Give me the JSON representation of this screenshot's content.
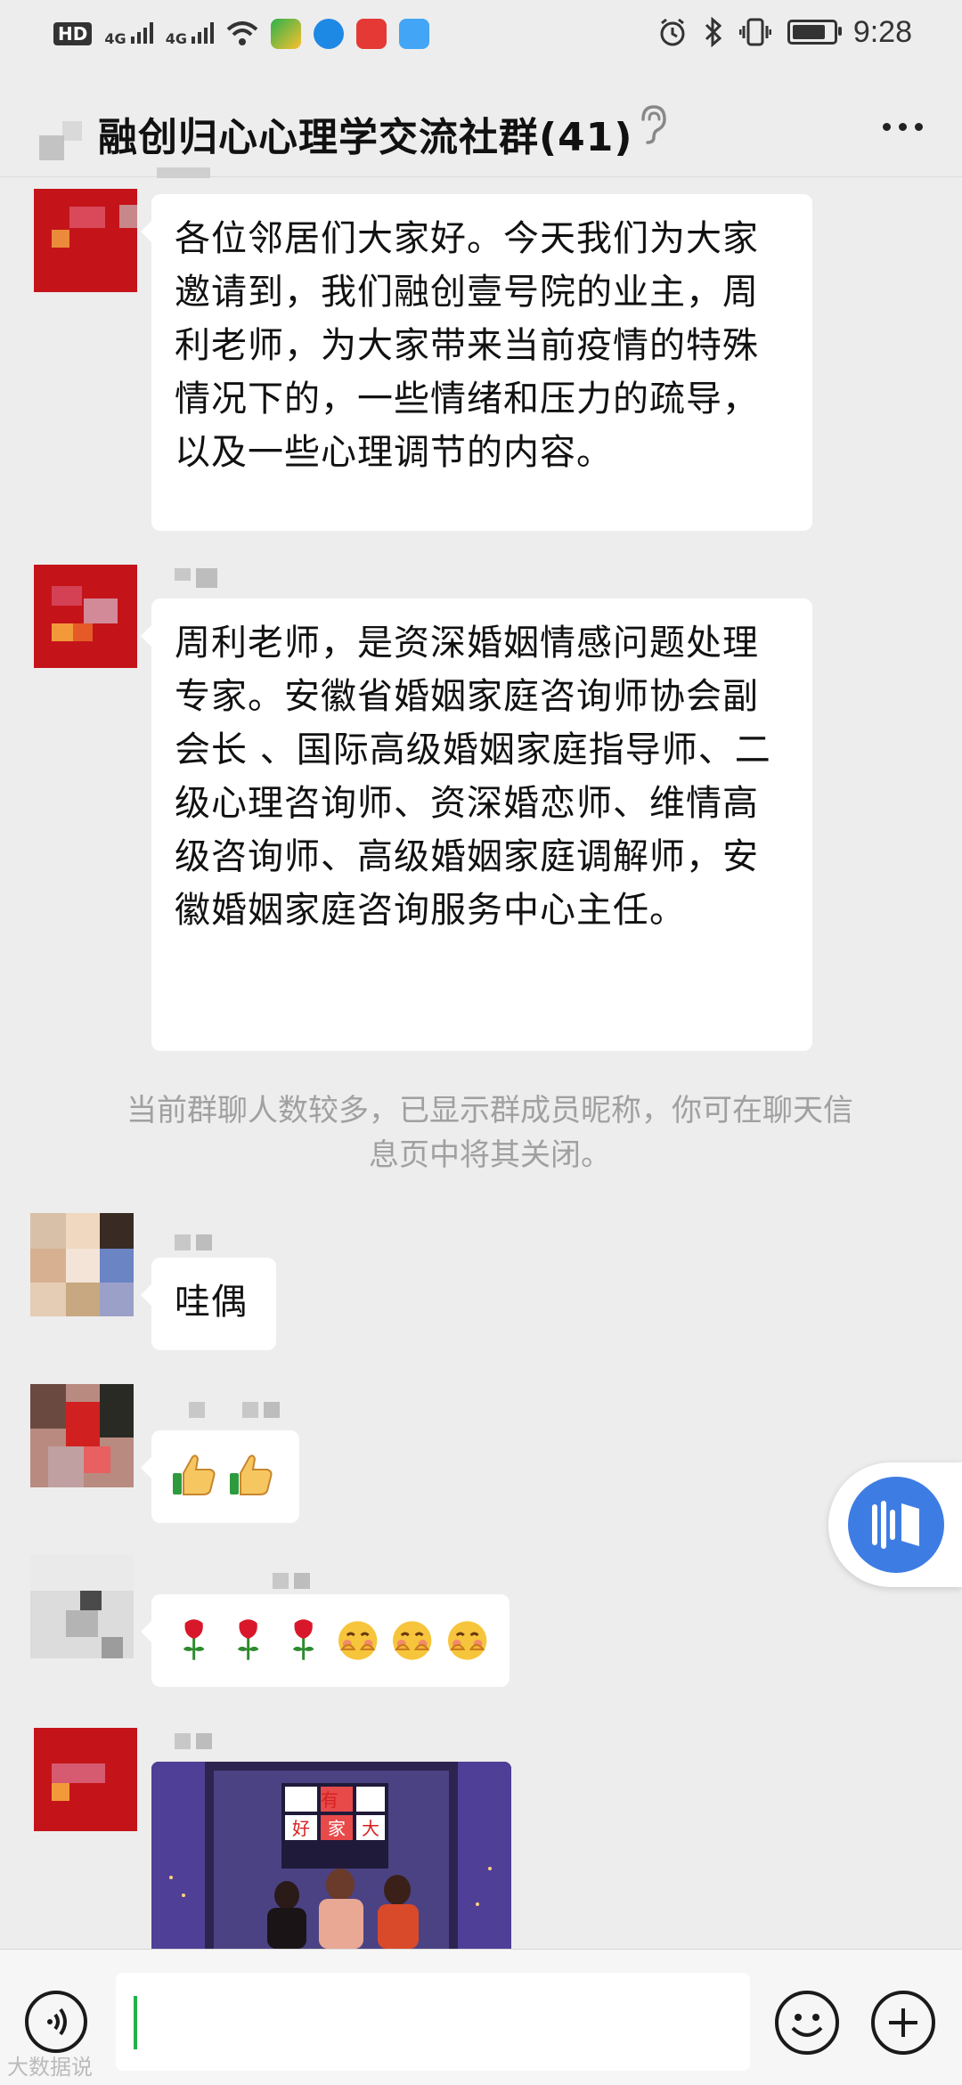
{
  "status_bar": {
    "network": "HD",
    "signal1": "4G",
    "signal2": "4G",
    "time": "9:28"
  },
  "header": {
    "title": "融创归心心理学交流社群(41)",
    "icons": [
      "ear-icon",
      "more-icon"
    ]
  },
  "messages": [
    {
      "type": "text",
      "text": "各位邻居们大家好。今天我们为大家邀请到，我们融创壹号院的业主，周利老师，为大家带来当前疫情的特殊情况下的，一些情绪和压力的疏导，以及一些心理调节的内容。"
    },
    {
      "type": "text",
      "text": "周利老师，是资深婚姻情感问题处理专家。安徽省婚姻家庭咨询师协会副会长 、国际高级婚姻家庭指导师、二级心理咨询师、资深婚恋师、维情高级咨询师、高级婚姻家庭调解师，安徽婚姻家庭咨询服务中心主任。"
    },
    {
      "type": "system",
      "text": "当前群聊人数较多，已显示群成员昵称，你可在聊天信息页中将其关闭。"
    },
    {
      "type": "text",
      "text": "哇偶"
    },
    {
      "type": "emoji",
      "icons": [
        "thumbs-up-icon",
        "thumbs-up-icon"
      ]
    },
    {
      "type": "emoji",
      "icons": [
        "rose-icon",
        "rose-icon",
        "rose-icon",
        "blush-face-icon",
        "blush-face-icon",
        "blush-face-icon"
      ]
    },
    {
      "type": "image",
      "sign_chars": [
        "有",
        "大",
        "好",
        "家"
      ]
    }
  ],
  "input_bar": {
    "value": "",
    "icons": [
      "voice-icon",
      "emoji-icon",
      "plus-icon"
    ]
  },
  "colors": {
    "accent": "#3d7de3",
    "caret": "#21b14a",
    "background": "#ededed"
  },
  "watermark": "大数据说"
}
